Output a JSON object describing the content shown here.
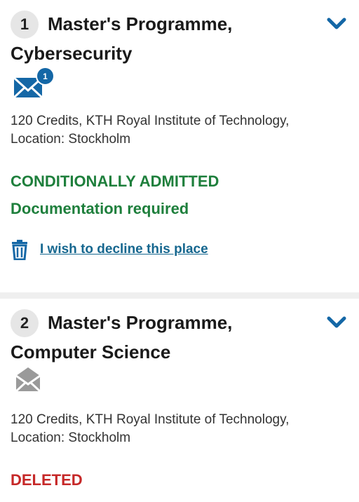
{
  "colors": {
    "accent_blue": "#1467a6",
    "admitted_green": "#1e7f3c",
    "deleted_red": "#c62828",
    "link_blue": "#16678f"
  },
  "applications": [
    {
      "number": "1",
      "title_line1": "Master's Programme,",
      "title_line2": "Cybersecurity",
      "expand_icon": "chevron-down-icon",
      "message_icon": "envelope-icon",
      "message_count": "1",
      "info_line1": "120 Credits, KTH Royal Institute of Technology,",
      "info_line2": "Location: Stockholm",
      "status": "CONDITIONALLY ADMITTED",
      "substatus": "Documentation required",
      "decline_icon": "trash-icon",
      "decline_label": "I wish to decline this place"
    },
    {
      "number": "2",
      "title_line1": "Master's Programme,",
      "title_line2": "Computer Science",
      "expand_icon": "chevron-down-icon",
      "message_icon": "envelope-open-icon",
      "info_line1": "120 Credits, KTH Royal Institute of Technology,",
      "info_line2": "Location: Stockholm",
      "status": "DELETED"
    }
  ]
}
